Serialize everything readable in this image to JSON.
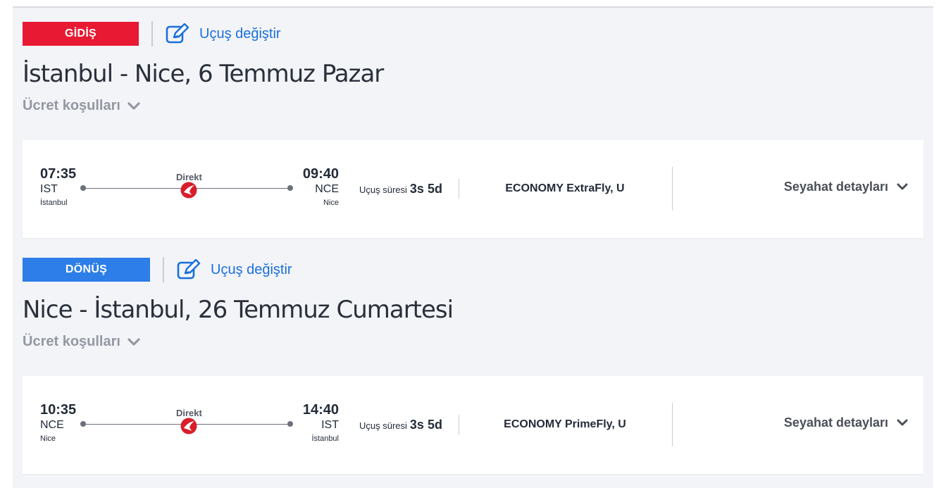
{
  "outbound": {
    "tag": "GİDİŞ",
    "change_label": "Uçuş değiştir",
    "title": "İstanbul - Nice, 6 Temmuz Pazar",
    "fare_conditions": "Ücret koşulları",
    "flight": {
      "dep_time": "07:35",
      "dep_code": "IST",
      "dep_city": "İstanbul",
      "arr_time": "09:40",
      "arr_code": "NCE",
      "arr_city": "Nice",
      "stop_label": "Direkt",
      "duration_label": "Uçuş süresi",
      "duration_value": "3s 5d",
      "cabin": "ECONOMY ExtraFly, U",
      "details_label": "Seyahat detayları"
    }
  },
  "return": {
    "tag": "DÖNÜŞ",
    "change_label": "Uçuş değiştir",
    "title": "Nice - İstanbul, 26 Temmuz Cumartesi",
    "fare_conditions": "Ücret koşulları",
    "flight": {
      "dep_time": "10:35",
      "dep_code": "NCE",
      "dep_city": "Nice",
      "arr_time": "14:40",
      "arr_code": "IST",
      "arr_city": "İstanbul",
      "stop_label": "Direkt",
      "duration_label": "Uçuş süresi",
      "duration_value": "3s 5d",
      "cabin": "ECONOMY PrimeFly, U",
      "details_label": "Seyahat detayları"
    }
  },
  "icons": {
    "edit": "edit-icon",
    "chevron": "chevron-down-icon",
    "airline": "turkish-airlines-logo-icon"
  },
  "colors": {
    "outbound_tag": "#e81932",
    "return_tag": "#2d7ee8",
    "link": "#1a6fdc",
    "background": "#f3f4f7"
  }
}
